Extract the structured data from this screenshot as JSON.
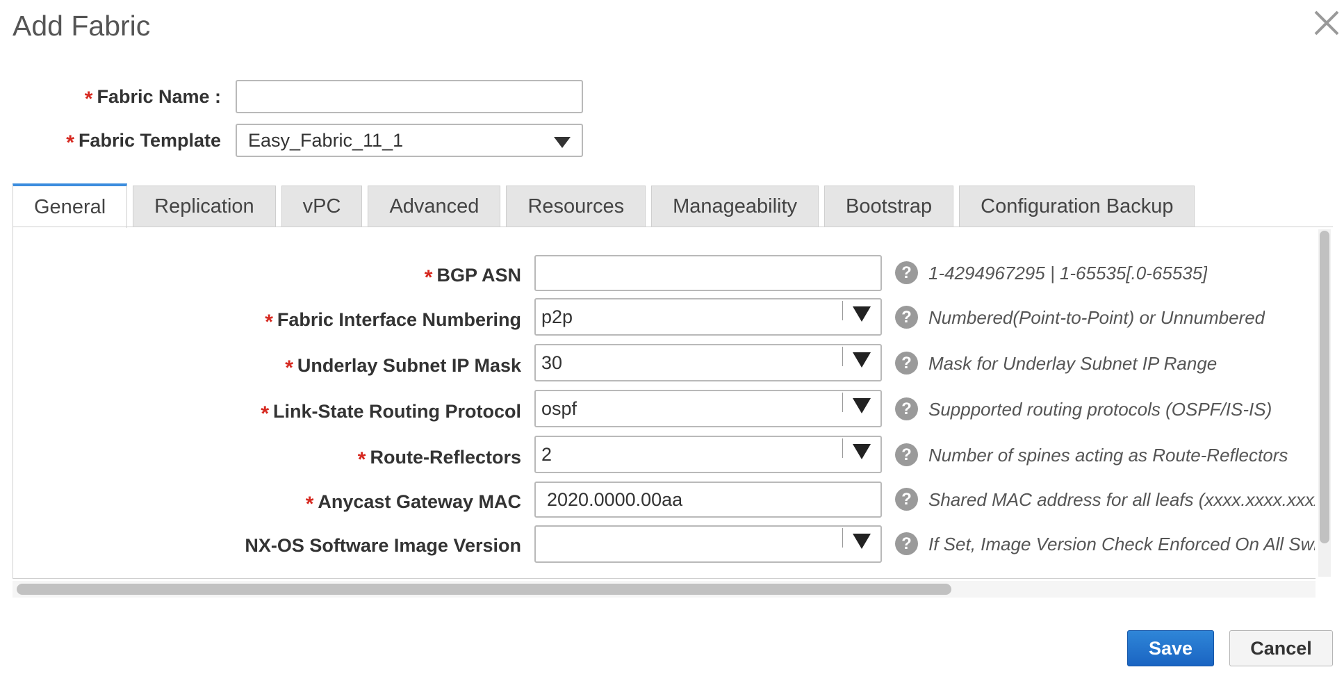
{
  "dialog": {
    "title": "Add Fabric"
  },
  "top_fields": {
    "fabric_name": {
      "label": "Fabric Name :",
      "value": ""
    },
    "fabric_template": {
      "label": "Fabric Template",
      "value": "Easy_Fabric_11_1"
    }
  },
  "tabs": [
    "General",
    "Replication",
    "vPC",
    "Advanced",
    "Resources",
    "Manageability",
    "Bootstrap",
    "Configuration Backup"
  ],
  "active_tab": "General",
  "general": {
    "fields": [
      {
        "label": "BGP ASN",
        "required": true,
        "value": "",
        "help": "1-4294967295 | 1-65535[.0-65535]"
      },
      {
        "label": "Fabric Interface Numbering",
        "required": true,
        "value": "p2p",
        "help": "Numbered(Point-to-Point) or Unnumbered"
      },
      {
        "label": "Underlay Subnet IP Mask",
        "required": true,
        "value": "30",
        "help": "Mask for Underlay Subnet IP Range"
      },
      {
        "label": "Link-State Routing Protocol",
        "required": true,
        "value": "ospf",
        "help": "Suppported routing protocols (OSPF/IS-IS)"
      },
      {
        "label": "Route-Reflectors",
        "required": true,
        "value": "2",
        "help": "Number of spines acting as Route-Reflectors"
      },
      {
        "label": "Anycast Gateway MAC",
        "required": true,
        "value": "2020.0000.00aa",
        "help": "Shared MAC address for all leafs (xxxx.xxxx.xxxx)"
      },
      {
        "label": "NX-OS Software Image Version",
        "required": false,
        "value": "",
        "help": "If Set, Image Version Check Enforced On All Switches"
      }
    ]
  },
  "footer": {
    "save_label": "Save",
    "cancel_label": "Cancel"
  },
  "icons": {
    "close": "close-icon",
    "help": "help-icon",
    "dropdown": "chevron-down-icon"
  },
  "colors": {
    "accent": "#1a64c2",
    "required": "#d6281f",
    "active_tab": "#3c8dde"
  }
}
